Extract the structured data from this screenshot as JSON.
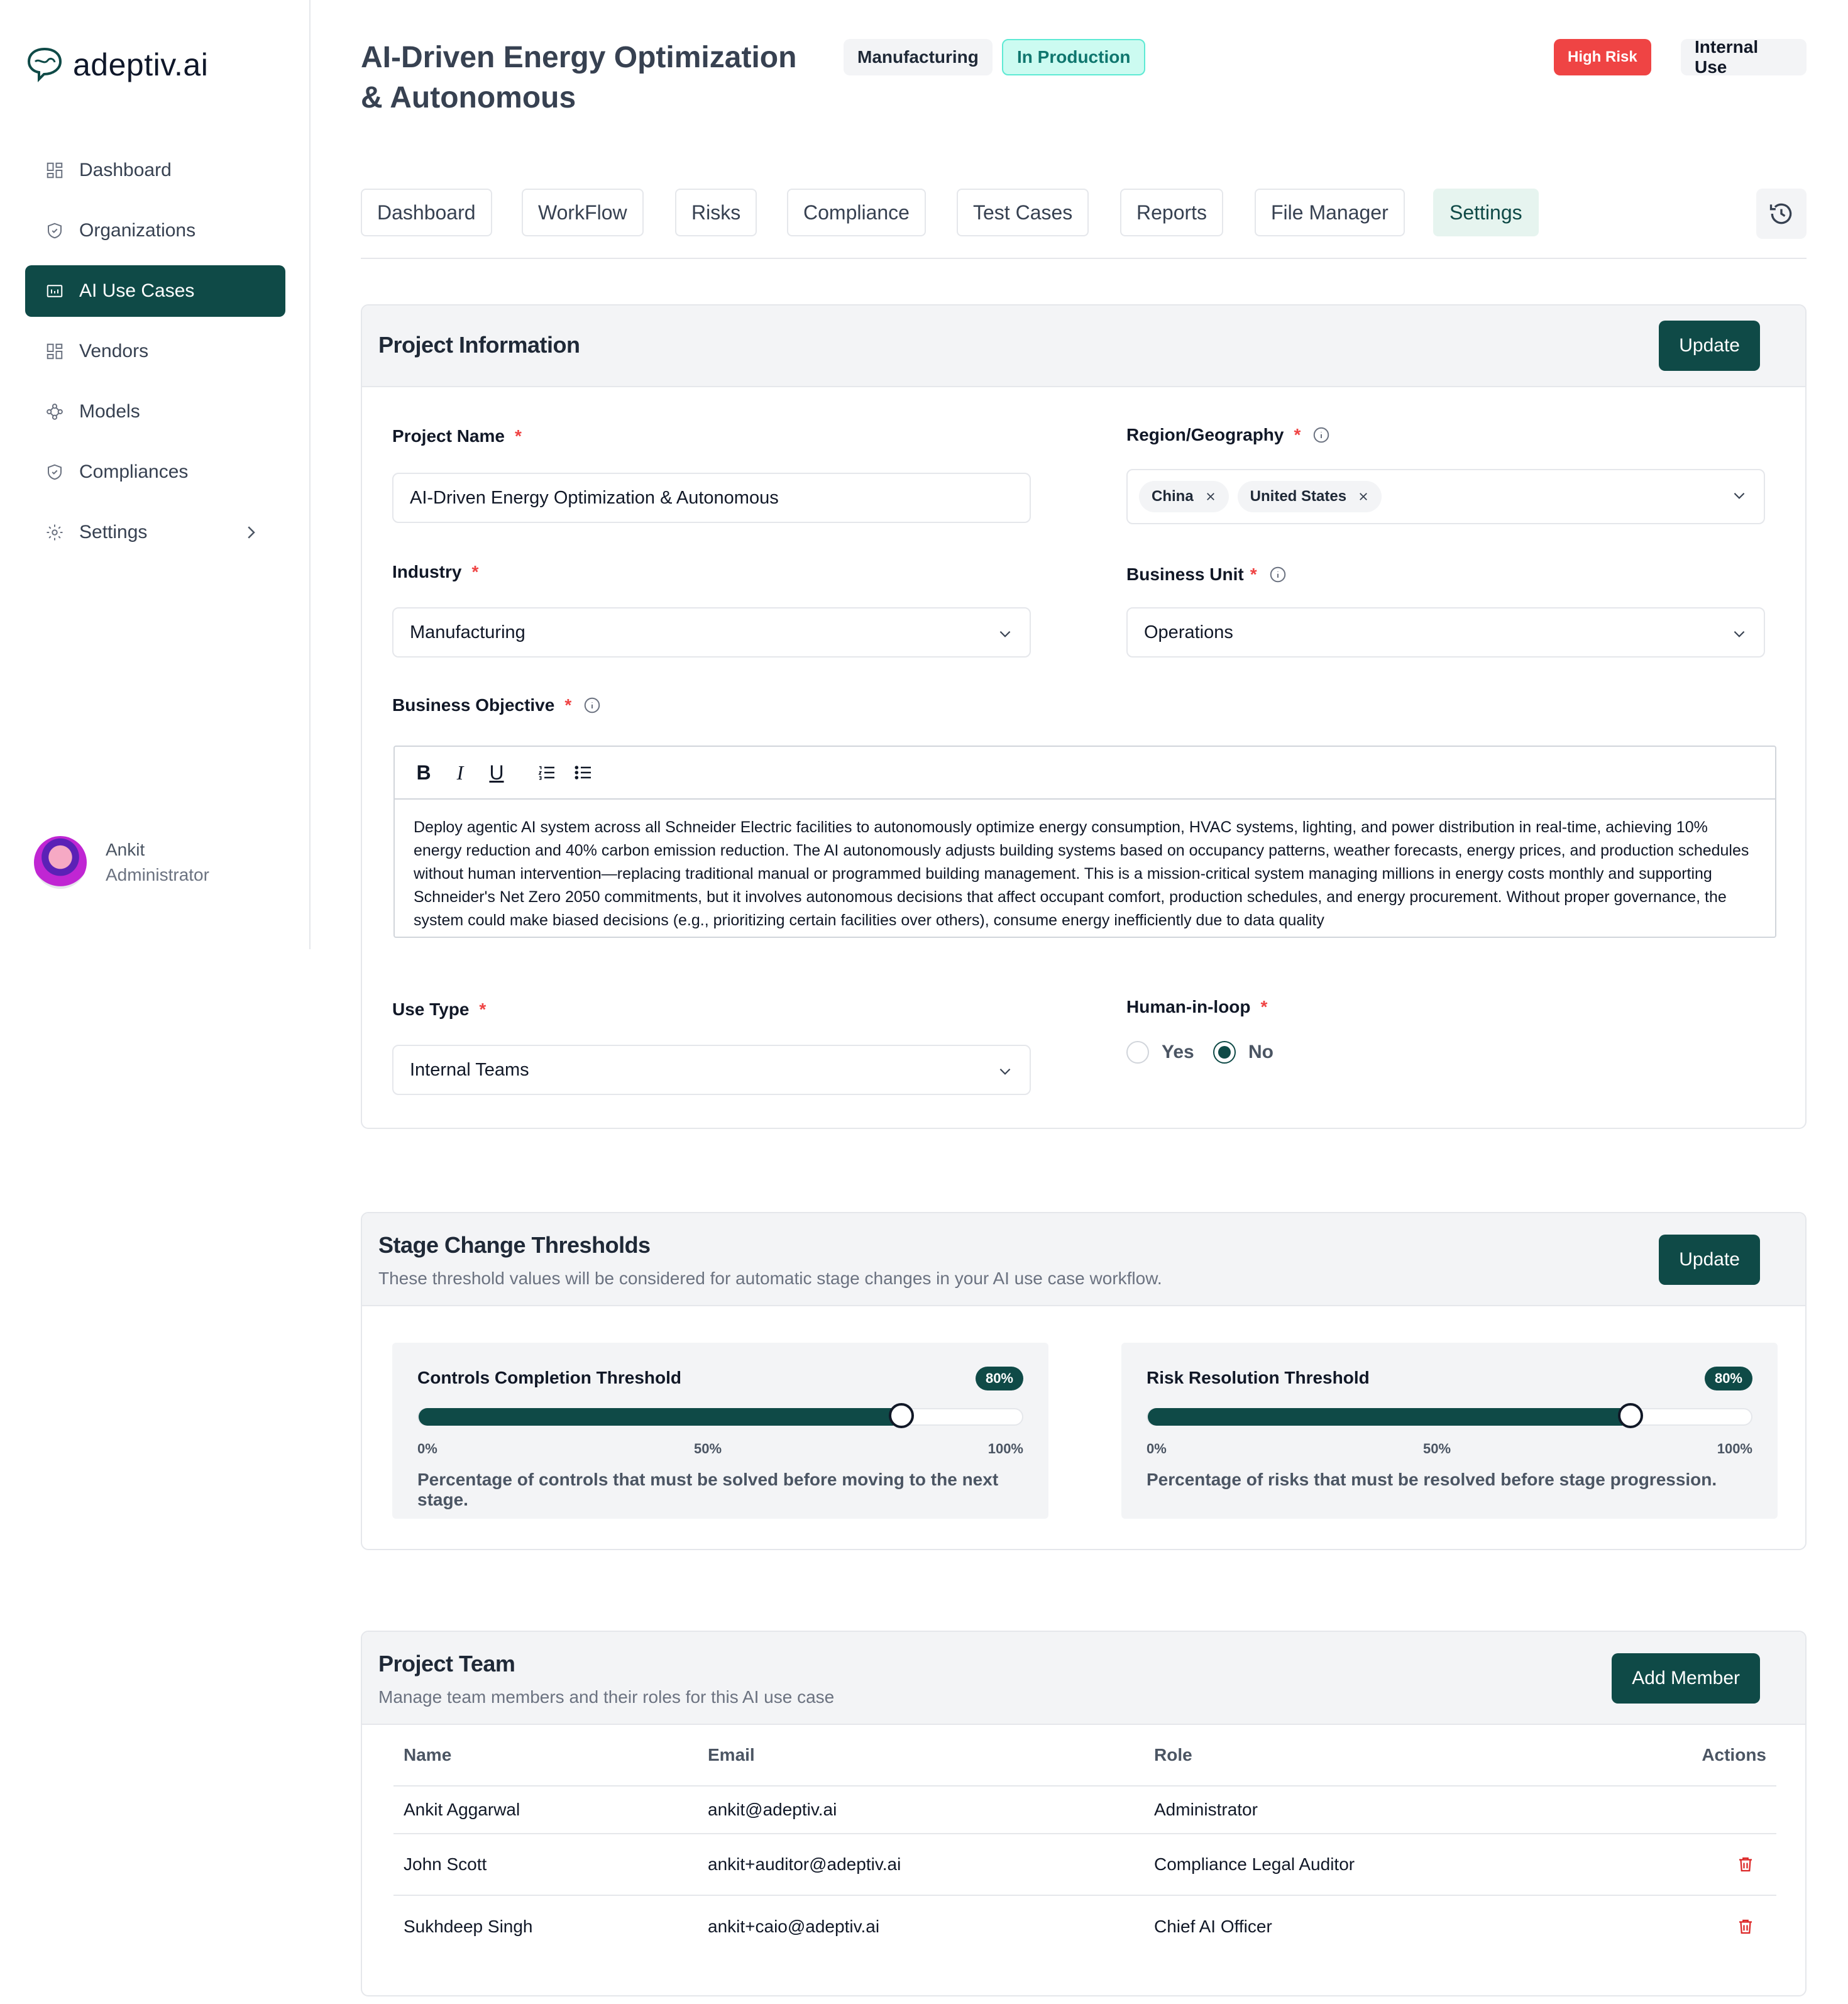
{
  "brand": {
    "name": "adeptiv.ai",
    "accent": "#0f4a47"
  },
  "sidebar": {
    "items": [
      {
        "label": "Dashboard",
        "icon": "grid-icon"
      },
      {
        "label": "Organizations",
        "icon": "shield-icon"
      },
      {
        "label": "AI Use Cases",
        "icon": "folder-icon",
        "active": true
      },
      {
        "label": "Vendors",
        "icon": "grid-icon"
      },
      {
        "label": "Models",
        "icon": "nodes-icon"
      },
      {
        "label": "Compliances",
        "icon": "shield-icon"
      },
      {
        "label": "Settings",
        "icon": "gear-icon"
      }
    ],
    "user": {
      "name": "Ankit",
      "role": "Administrator"
    }
  },
  "header": {
    "title": "AI-Driven Energy Optimization & Autonomous",
    "badges": {
      "industry": "Manufacturing",
      "status": "In Production",
      "risk": "High Risk",
      "use": "Internal Use"
    }
  },
  "tabs": [
    "Dashboard",
    "WorkFlow",
    "Risks",
    "Compliance",
    "Test Cases",
    "Reports",
    "File Manager",
    "Settings"
  ],
  "project_info": {
    "title": "Project Information",
    "update_label": "Update",
    "project_name_label": "Project Name",
    "project_name_value": "AI-Driven Energy Optimization & Autonomous",
    "region_label": "Region/Geography",
    "regions": [
      "China",
      "United States"
    ],
    "industry_label": "Industry",
    "industry_value": "Manufacturing",
    "business_unit_label": "Business Unit",
    "business_unit_value": "Operations",
    "objective_label": "Business Objective",
    "objective_text": "Deploy agentic AI system across all Schneider Electric facilities to autonomously optimize energy consumption, HVAC systems, lighting, and power distribution in real-time, achieving 10% energy reduction and 40% carbon emission reduction. The AI autonomously adjusts building systems based on occupancy patterns, weather forecasts, energy prices, and production schedules without human intervention—replacing traditional manual or programmed building management. This is a mission-critical system managing millions in energy costs monthly and supporting Schneider's Net Zero 2050 commitments, but it involves autonomous decisions that affect occupant comfort, production schedules, and energy procurement. Without proper governance, the system could make biased decisions (e.g., prioritizing certain facilities over others), consume energy inefficiently due to data quality",
    "use_type_label": "Use Type",
    "use_type_value": "Internal Teams",
    "hil_label": "Human-in-loop",
    "hil_yes": "Yes",
    "hil_no": "No",
    "hil_selected": "No"
  },
  "thresholds": {
    "title": "Stage Change Thresholds",
    "subtitle": "These threshold values will be considered for automatic stage changes in your AI use case workflow.",
    "update_label": "Update",
    "controls": {
      "title": "Controls Completion Threshold",
      "value": 80,
      "badge": "80%",
      "desc": "Percentage of controls that must be solved before moving to the next stage."
    },
    "risks": {
      "title": "Risk Resolution Threshold",
      "value": 80,
      "badge": "80%",
      "desc": "Percentage of risks that must be resolved before stage progression."
    },
    "ticks": [
      "0%",
      "50%",
      "100%"
    ]
  },
  "team": {
    "title": "Project Team",
    "subtitle": "Manage team members and their roles for this AI use case",
    "add_label": "Add Member",
    "columns": [
      "Name",
      "Email",
      "Role",
      "Actions"
    ],
    "rows": [
      {
        "name": "Ankit Aggarwal",
        "email": "ankit@adeptiv.ai",
        "role": "Administrator",
        "deletable": false
      },
      {
        "name": "John Scott",
        "email": "ankit+auditor@adeptiv.ai",
        "role": "Compliance Legal Auditor",
        "deletable": true
      },
      {
        "name": "Sukhdeep Singh",
        "email": "ankit+caio@adeptiv.ai",
        "role": "Chief AI Officer",
        "deletable": true
      }
    ]
  }
}
